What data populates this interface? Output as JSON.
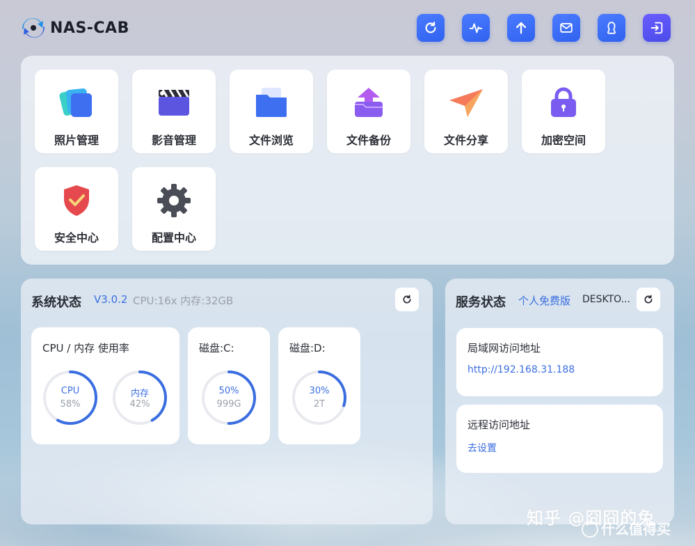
{
  "app": {
    "name": "NAS-CAB"
  },
  "toolbar": {
    "buttons": [
      {
        "icon": "refresh-icon"
      },
      {
        "icon": "activity-icon"
      },
      {
        "icon": "upload-icon"
      },
      {
        "icon": "mail-icon"
      },
      {
        "icon": "user-icon"
      },
      {
        "icon": "logout-icon"
      }
    ],
    "color": "#3566f4"
  },
  "apps": [
    {
      "label": "照片管理",
      "icon": "photos-icon"
    },
    {
      "label": "影音管理",
      "icon": "clapperboard-icon"
    },
    {
      "label": "文件浏览",
      "icon": "folder-icon"
    },
    {
      "label": "文件备份",
      "icon": "backup-icon"
    },
    {
      "label": "文件分享",
      "icon": "paper-plane-icon"
    },
    {
      "label": "加密空间",
      "icon": "lock-icon"
    },
    {
      "label": "安全中心",
      "icon": "shield-icon"
    },
    {
      "label": "配置中心",
      "icon": "gear-icon"
    }
  ],
  "system": {
    "title": "系统状态",
    "version": "V3.0.2",
    "specs": "CPU:16x 内存:32GB",
    "cards": {
      "cpu_mem": {
        "title": "CPU / 内存 使用率",
        "gauges": [
          {
            "name": "CPU",
            "value": "58%",
            "fraction": 0.58
          },
          {
            "name": "内存",
            "value": "42%",
            "fraction": 0.42
          }
        ]
      },
      "disk_c": {
        "title": "磁盘:C:",
        "gauge": {
          "name": "50%",
          "value": "999G",
          "fraction": 0.5
        }
      },
      "disk_d": {
        "title": "磁盘:D:",
        "gauge": {
          "name": "30%",
          "value": "2T",
          "fraction": 0.3
        }
      }
    }
  },
  "service": {
    "title": "服务状态",
    "edition": "个人免费版",
    "host": "DESKTO...",
    "lan": {
      "title": "局域网访问地址",
      "url": "http://192.168.31.188"
    },
    "remote": {
      "title": "远程访问地址",
      "link": "去设置"
    }
  },
  "watermark": {
    "line1": "知乎 @囧囧的兔",
    "line2": "什么值得买"
  },
  "colors": {
    "accent": "#3a6ee0",
    "gauge_track": "#e8eaef",
    "gauge_fill": "#3a6ee0"
  }
}
